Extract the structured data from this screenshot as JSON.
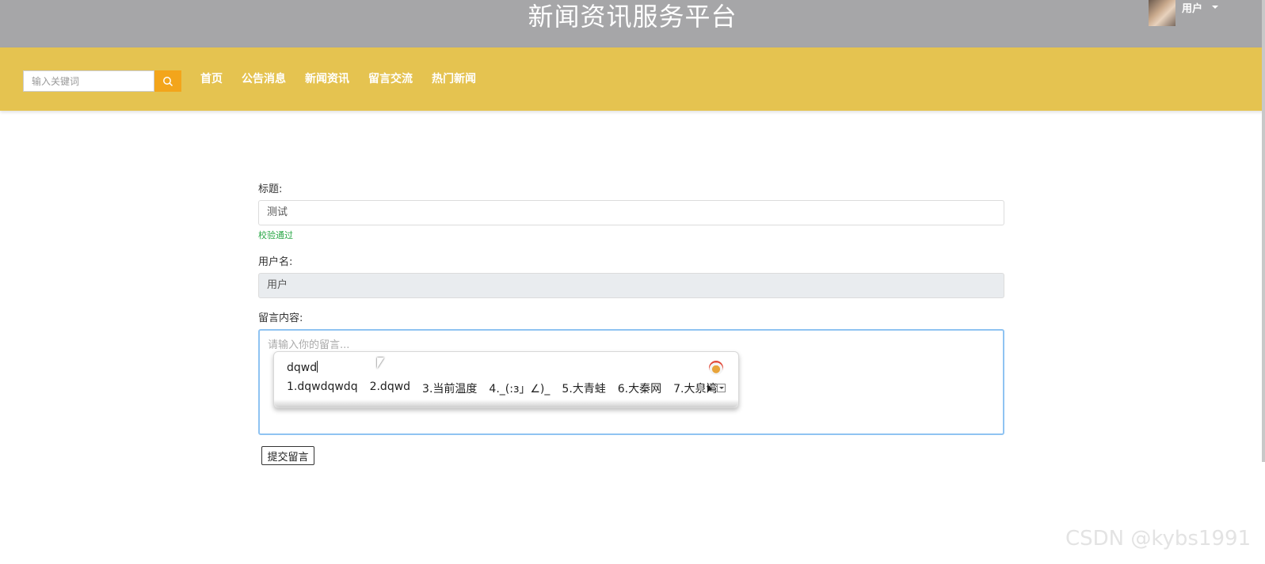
{
  "header": {
    "site_title": "新闻资讯服务平台",
    "user_name": "用户"
  },
  "nav": {
    "search_placeholder": "输入关键词",
    "links": [
      "首页",
      "公告消息",
      "新闻资讯",
      "留言交流",
      "热门新闻"
    ]
  },
  "form": {
    "title_label": "标题:",
    "title_value": "测试",
    "title_valid_msg": "校验通过",
    "username_label": "用户名:",
    "username_value": "用户",
    "content_label": "留言内容:",
    "content_placeholder": "请输入你的留言...",
    "submit_label": "提交留言"
  },
  "ime": {
    "input": "dqwd",
    "candidates": [
      "1.dqwdqwdq",
      "2.dqwd",
      "3.当前温度",
      "4._(:з」∠)_",
      "5.大青蛙",
      "6.大秦网",
      "7.大泉湾"
    ]
  },
  "watermark": "CSDN @kybs1991",
  "colors": {
    "topbar": "#a6a6a8",
    "navbar": "#e5c350",
    "search_button": "#f3a51b",
    "valid_text": "#28a745",
    "textarea_focus_border": "#8fc3f2"
  }
}
